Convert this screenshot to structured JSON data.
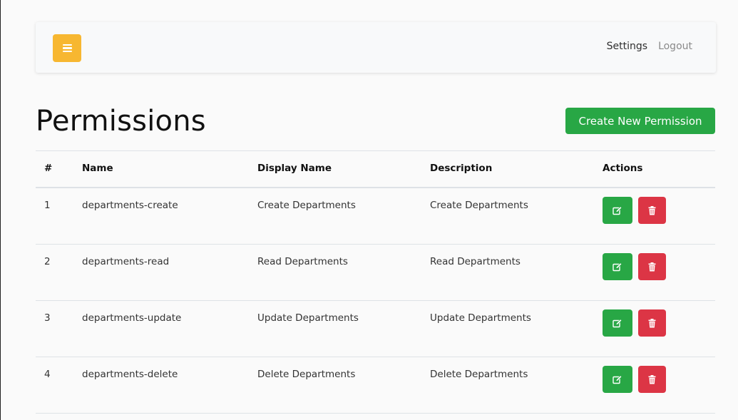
{
  "navbar": {
    "menu_icon": "hamburger-icon",
    "links": [
      "Settings",
      "Logout"
    ]
  },
  "page": {
    "title": "Permissions",
    "create_button": "Create New Permission"
  },
  "table": {
    "headers": [
      "#",
      "Name",
      "Display Name",
      "Description",
      "Actions"
    ],
    "rows": [
      {
        "id": "1",
        "name": "departments-create",
        "display_name": "Create Departments",
        "description": "Create Departments"
      },
      {
        "id": "2",
        "name": "departments-read",
        "display_name": "Read Departments",
        "description": "Read Departments"
      },
      {
        "id": "3",
        "name": "departments-update",
        "display_name": "Update Departments",
        "description": "Update Departments"
      },
      {
        "id": "4",
        "name": "departments-delete",
        "display_name": "Delete Departments",
        "description": "Delete Departments"
      }
    ],
    "row_actions": {
      "edit_icon": "edit-icon",
      "delete_icon": "trash-icon"
    }
  },
  "colors": {
    "menu_button": "#f7b731",
    "success": "#28a745",
    "danger": "#dc3545"
  }
}
